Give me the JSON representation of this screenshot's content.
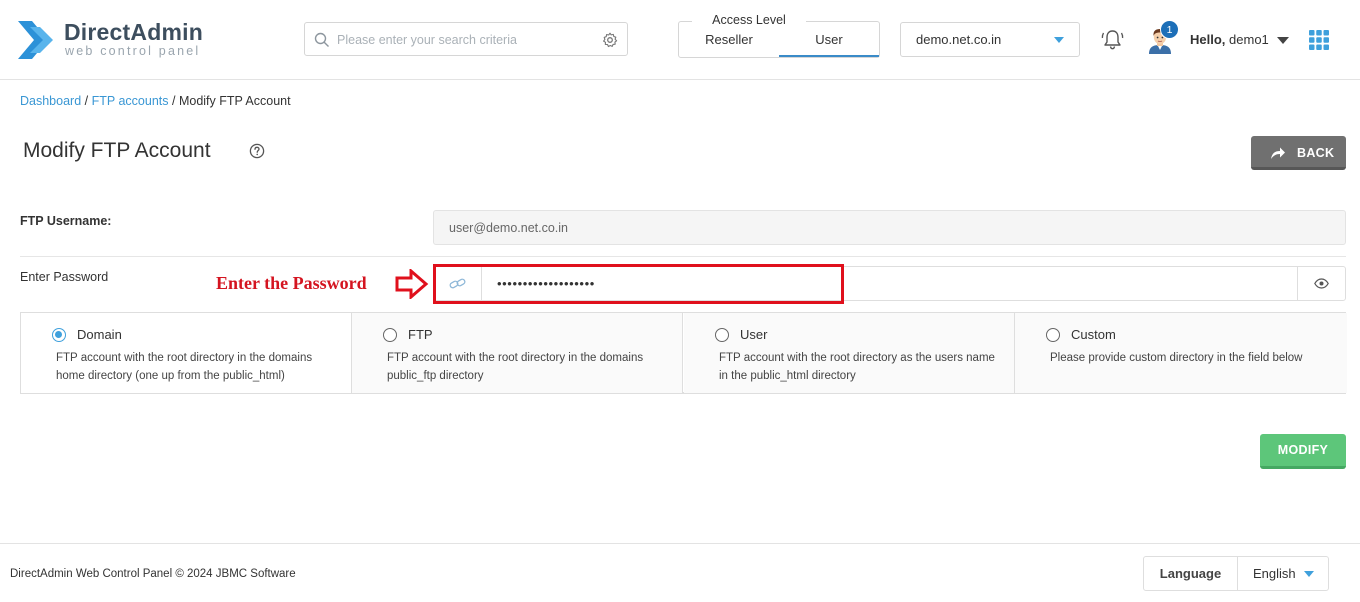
{
  "colors": {
    "accent": "#3fa0dc",
    "link": "#3a97d4",
    "back_button": "#707070",
    "modify_button": "#5dc67a",
    "annotation": "#e0101c"
  },
  "header": {
    "logo_title": "DirectAdmin",
    "logo_subtitle": "web control panel",
    "search_placeholder": "Please enter your search criteria",
    "access_level": {
      "label": "Access Level",
      "tabs": [
        "Reseller",
        "User"
      ],
      "selected": "User"
    },
    "domain": "demo.net.co.in",
    "notification_count": "1",
    "greeting": "Hello,",
    "username": "demo1",
    "icons": [
      "search-icon",
      "settings-gear-icon",
      "bell-icon",
      "user-avatar-icon",
      "chevron-down-icon",
      "apps-grid-icon"
    ]
  },
  "breadcrumb": {
    "items": [
      "Dashboard",
      "FTP accounts",
      "Modify FTP Account"
    ],
    "separator": "/"
  },
  "page": {
    "title": "Modify FTP Account",
    "back_label": "BACK"
  },
  "form": {
    "username_label": "FTP Username:",
    "username_value": "user@demo.net.co.in",
    "password_label": "Enter Password",
    "password_value": "•••••••••••••••••••",
    "annotation": "Enter the Password"
  },
  "directory_options": [
    {
      "title": "Domain",
      "desc": "FTP account with the root directory in the domains home directory (one up from the public_html)",
      "checked": true
    },
    {
      "title": "FTP",
      "desc": "FTP account with the root directory in the domains public_ftp directory",
      "checked": false
    },
    {
      "title": "User",
      "desc": "FTP account with the root directory as the users name in the public_html directory",
      "checked": false
    },
    {
      "title": "Custom",
      "desc": "Please provide custom directory in the field below",
      "checked": false
    }
  ],
  "modify_label": "MODIFY",
  "footer": {
    "copyright": "DirectAdmin Web Control Panel © 2024 JBMC Software",
    "language_label": "Language",
    "language_value": "English"
  }
}
